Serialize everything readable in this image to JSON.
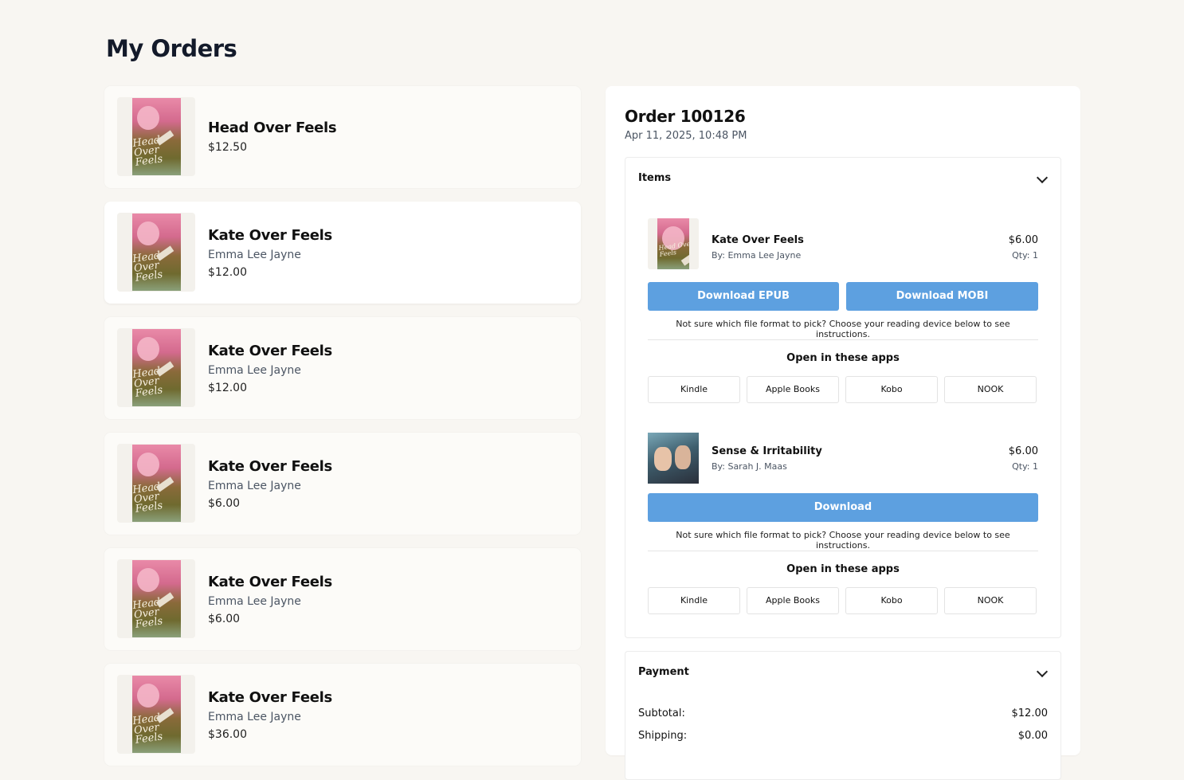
{
  "page": {
    "title": "My Orders"
  },
  "orders": [
    {
      "title": "Head Over Feels",
      "author": "",
      "price": "$12.50",
      "cover_text": "Head Over Feels"
    },
    {
      "title": "Kate Over Feels",
      "author": "Emma Lee Jayne",
      "price": "$12.00",
      "cover_text": "Head Over Feels"
    },
    {
      "title": "Kate Over Feels",
      "author": "Emma Lee Jayne",
      "price": "$12.00",
      "cover_text": "Head Over Feels"
    },
    {
      "title": "Kate Over Feels",
      "author": "Emma Lee Jayne",
      "price": "$6.00",
      "cover_text": "Head Over Feels"
    },
    {
      "title": "Kate Over Feels",
      "author": "Emma Lee Jayne",
      "price": "$6.00",
      "cover_text": "Head Over Feels"
    },
    {
      "title": "Kate Over Feels",
      "author": "Emma Lee Jayne",
      "price": "$36.00",
      "cover_text": "Head Over Feels"
    }
  ],
  "detail": {
    "order_label": "Order 100126",
    "date": "Apr 11, 2025, 10:48 PM",
    "items_section": {
      "label": "Items",
      "items": [
        {
          "name": "Kate Over Feels",
          "author": "By: Emma Lee Jayne",
          "price": "$6.00",
          "qty": "Qty: 1",
          "cover_text": "Head Over Feels",
          "download_epub": "Download EPUB",
          "download_mobi": "Download MOBI",
          "hint": "Not sure which file format to pick? Choose your reading device below to see instructions.",
          "apps_title": "Open in these apps",
          "apps": [
            "Kindle",
            "Apple Books",
            "Kobo",
            "NOOK"
          ]
        },
        {
          "name": "Sense & Irritability",
          "author": "By: Sarah J. Maas",
          "price": "$6.00",
          "qty": "Qty: 1",
          "download": "Download",
          "hint": "Not sure which file format to pick? Choose your reading device below to see instructions.",
          "apps_title": "Open in these apps",
          "apps": [
            "Kindle",
            "Apple Books",
            "Kobo",
            "NOOK"
          ]
        }
      ]
    },
    "payment_section": {
      "label": "Payment",
      "subtotal_label": "Subtotal:",
      "subtotal_value": "$12.00",
      "shipping_label": "Shipping:",
      "shipping_value": "$0.00"
    }
  },
  "colors": {
    "background": "#f8f6f2",
    "accent": "#5da0e0",
    "card": "#fcfbf8"
  }
}
